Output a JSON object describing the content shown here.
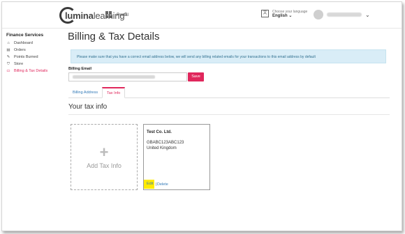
{
  "header": {
    "logo_brand": "lumina",
    "logo_suffix": "learning",
    "logo_tm": "®",
    "portal_label": "Portal",
    "language_caption": "Choose your language",
    "language_value": "English"
  },
  "sidebar": {
    "title": "Finance Services",
    "items": [
      {
        "label": "Dashboard",
        "icon": "⌂"
      },
      {
        "label": "Orders",
        "icon": "▤"
      },
      {
        "label": "Points Burned",
        "icon": "✎"
      },
      {
        "label": "Store",
        "icon": "⛉"
      },
      {
        "label": "Billing & Tax Details",
        "icon": "▭"
      }
    ]
  },
  "main": {
    "title": "Billing & Tax Details",
    "alert": "Please make sure that you have a correct email address below, we will send any billing related emails for your transactions to this email address by default",
    "email_label": "Billing Email",
    "save_label": "Save",
    "tabs": [
      {
        "label": "Billing Address"
      },
      {
        "label": "Tax Info"
      }
    ],
    "section_title": "Your tax info",
    "add_card": {
      "plus": "+",
      "label": "Add Tax Info"
    },
    "tax_card": {
      "company": "Test Co. Ltd.",
      "tax_id": "GBABC123ABC123",
      "country": "United Kingdom",
      "edit": "Edit",
      "separator": "|",
      "delete": "Delete"
    }
  },
  "colors": {
    "accent": "#e0275c",
    "link": "#337ab7",
    "alert_bg": "#d9edf7",
    "highlight": "#ffeb00"
  }
}
